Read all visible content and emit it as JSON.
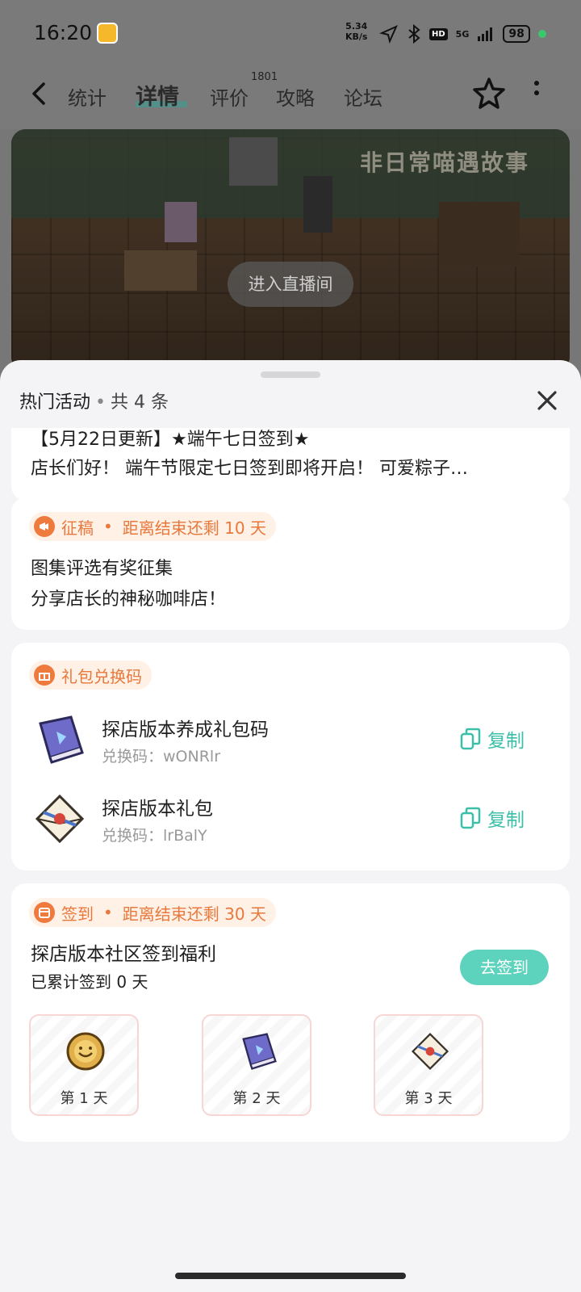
{
  "status_bar": {
    "time": "16:20",
    "net_speed": "5.34",
    "net_unit": "KB/s",
    "hd": "HD",
    "network": "5G",
    "battery": "98"
  },
  "header": {
    "tabs": [
      "统计",
      "详情",
      "评价",
      "攻略",
      "论坛"
    ],
    "review_count": "1801"
  },
  "banner": {
    "logo_text": "非日常喵遇故事",
    "live_button": "进入直播间"
  },
  "sheet": {
    "title": "热门活动",
    "count": "共 4 条",
    "cards": {
      "notice": {
        "line1": "【5月22日更新】★端午七日签到★",
        "line2": "店长们好！ 端午节限定七日签到即将开启！ 可爱粽子…"
      },
      "contest": {
        "tag": "征稿",
        "remaining": "距离结束还剩 10 天",
        "title": "图集评选有奖征集",
        "subtitle": "分享店长的神秘咖啡店！"
      },
      "gift_codes": {
        "tag": "礼包兑换码",
        "items": [
          {
            "name": "探店版本养成礼包码",
            "code": "兑换码：wONRlr",
            "action": "复制"
          },
          {
            "name": "探店版本礼包",
            "code": "兑换码：lrBalY",
            "action": "复制"
          }
        ]
      },
      "checkin": {
        "tag": "签到",
        "remaining": "距离结束还剩 30 天",
        "title": "探店版本社区签到福利",
        "progress": "已累计签到 0 天",
        "button": "去签到",
        "days": [
          "第 1 天",
          "第 2 天",
          "第 3 天"
        ]
      }
    }
  },
  "colors": {
    "accent": "#3bbfa9",
    "tag": "#e8783c",
    "tag_bg": "#fff1e6",
    "button": "#5dd2bd"
  }
}
